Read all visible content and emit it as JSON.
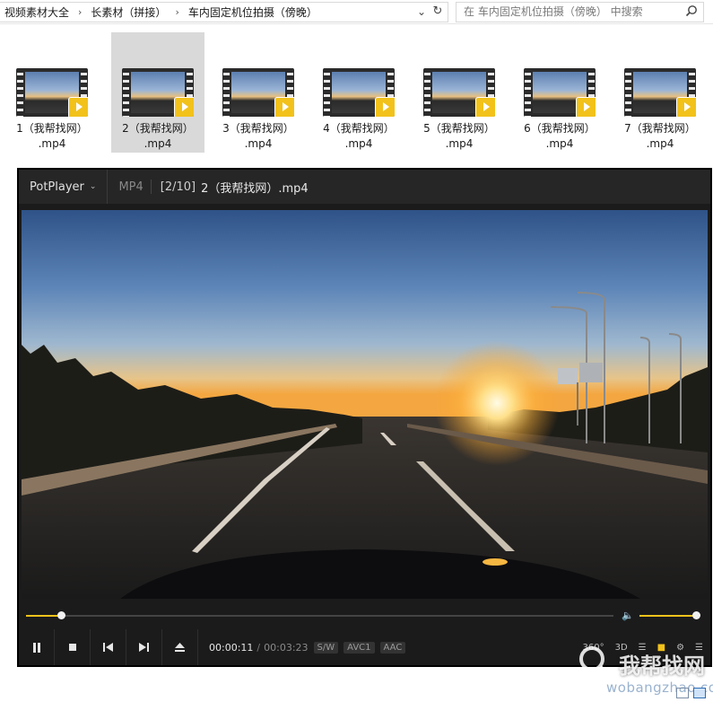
{
  "explorer": {
    "breadcrumb": [
      "视频素材大全",
      "长素材（拼接）",
      "车内固定机位拍摄（傍晚）"
    ],
    "search_placeholder": "在 车内固定机位拍摄（傍晚） 中搜索",
    "files": [
      {
        "line1": "1（我帮找网）",
        "line2": ".mp4",
        "selected": false
      },
      {
        "line1": "2（我帮找网）",
        "line2": ".mp4",
        "selected": true
      },
      {
        "line1": "3（我帮找网）",
        "line2": ".mp4",
        "selected": false
      },
      {
        "line1": "4（我帮找网）",
        "line2": ".mp4",
        "selected": false
      },
      {
        "line1": "5（我帮找网）",
        "line2": ".mp4",
        "selected": false
      },
      {
        "line1": "6（我帮找网）",
        "line2": ".mp4",
        "selected": false
      },
      {
        "line1": "7（我帮找网）",
        "line2": ".mp4",
        "selected": false
      }
    ]
  },
  "player": {
    "app_name": "PotPlayer",
    "format": "MP4",
    "playlist_position": "[2/10]",
    "file_title": "2（我帮找网）.mp4",
    "time_current": "00:00:11",
    "time_total": "00:03:23",
    "tags": [
      "S/W",
      "AVC1",
      "AAC"
    ],
    "right_controls": [
      "360°",
      "3D"
    ],
    "seek_fraction": 0.06,
    "volume_fraction": 0.98
  },
  "watermark": {
    "text": "我帮找网",
    "url": "wobangzhao.com"
  },
  "colors": {
    "accent": "#f2c21b",
    "player_bg": "#1b1b1b",
    "selection": "#d9d9d9"
  }
}
